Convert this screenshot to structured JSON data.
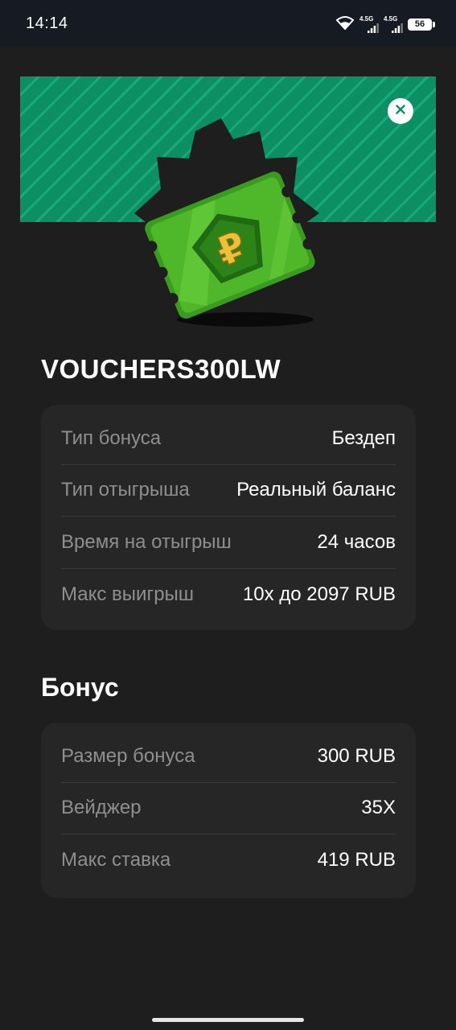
{
  "status_bar": {
    "time": "14:14",
    "network_1": "4.5G",
    "network_2": "4.5G",
    "battery": "56"
  },
  "colors": {
    "background": "#1e1e1e",
    "card": "#262626",
    "banner_green": "#0b8f63",
    "label_gray": "#8f8f8f"
  },
  "icons": {
    "close": "close-icon",
    "wifi": "wifi-icon",
    "signal": "signal-icon",
    "battery": "battery-icon",
    "voucher": "ruble-voucher-icon"
  },
  "promo_code": "VOUCHERS300LW",
  "info_rows": [
    {
      "label": "Тип бонуса",
      "value": "Бездеп"
    },
    {
      "label": "Тип отыгрыша",
      "value": "Реальный баланс"
    },
    {
      "label": "Время на отыгрыш",
      "value": "24 часов"
    },
    {
      "label": "Макс выигрыш",
      "value": "10x до 2097 RUB"
    }
  ],
  "bonus_section": {
    "title": "Бонус",
    "rows": [
      {
        "label": "Размер бонуса",
        "value": "300 RUB"
      },
      {
        "label": "Вейджер",
        "value": "35X"
      },
      {
        "label": "Макс ставка",
        "value": "419 RUB"
      }
    ]
  }
}
